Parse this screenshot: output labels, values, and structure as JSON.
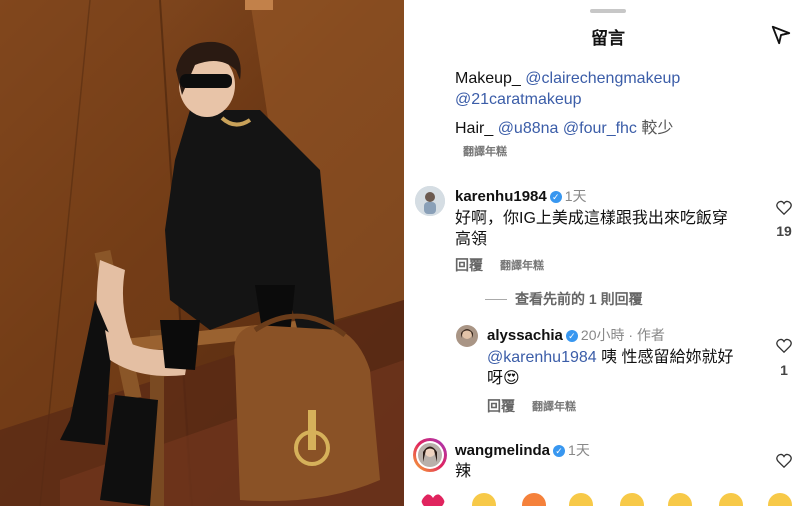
{
  "header": {
    "title": "留言"
  },
  "caption": {
    "line1_prefix": "Makeup_ ",
    "mention1": "@clairechengmakeup",
    "mention2": "@21caratmakeup",
    "line3_prefix": "Hair_ ",
    "mention3": "@u88na",
    "mention4": "@four_fhc",
    "less": " 較少",
    "translate": "翻譯年糕"
  },
  "comments": [
    {
      "username": "karenhu1984",
      "verified": "✓",
      "time": "1天",
      "text_line1": "好啊，你IG上美成這樣跟我出來吃飯穿",
      "text_line2": "高領",
      "reply_label": "回覆",
      "translate": "翻譯年糕",
      "likes": "19"
    },
    {
      "view_previous": "查看先前的 1 則回覆",
      "username": "alyssachia",
      "verified": "✓",
      "time": "20小時 · 作者",
      "mention": "@karenhu1984",
      "text_line1_rest": " 咦 性感留給妳就好",
      "text_line2": "呀😍",
      "reply_label": "回覆",
      "translate": "翻譯年糕",
      "likes": "1"
    },
    {
      "username": "wangmelinda",
      "verified": "✓",
      "time": "1天",
      "text_line1": "辣"
    }
  ],
  "emoji_bar": [
    "heart-emoji",
    "clap-emoji",
    "fire-emoji",
    "praise-emoji",
    "cry-laugh-emoji",
    "heart-eyes-emoji",
    "surprised-emoji",
    "laugh-emoji"
  ],
  "colors": {
    "mention": "#3b5da8",
    "verified": "#3897f0",
    "heart_emoji": "#e0245e"
  }
}
